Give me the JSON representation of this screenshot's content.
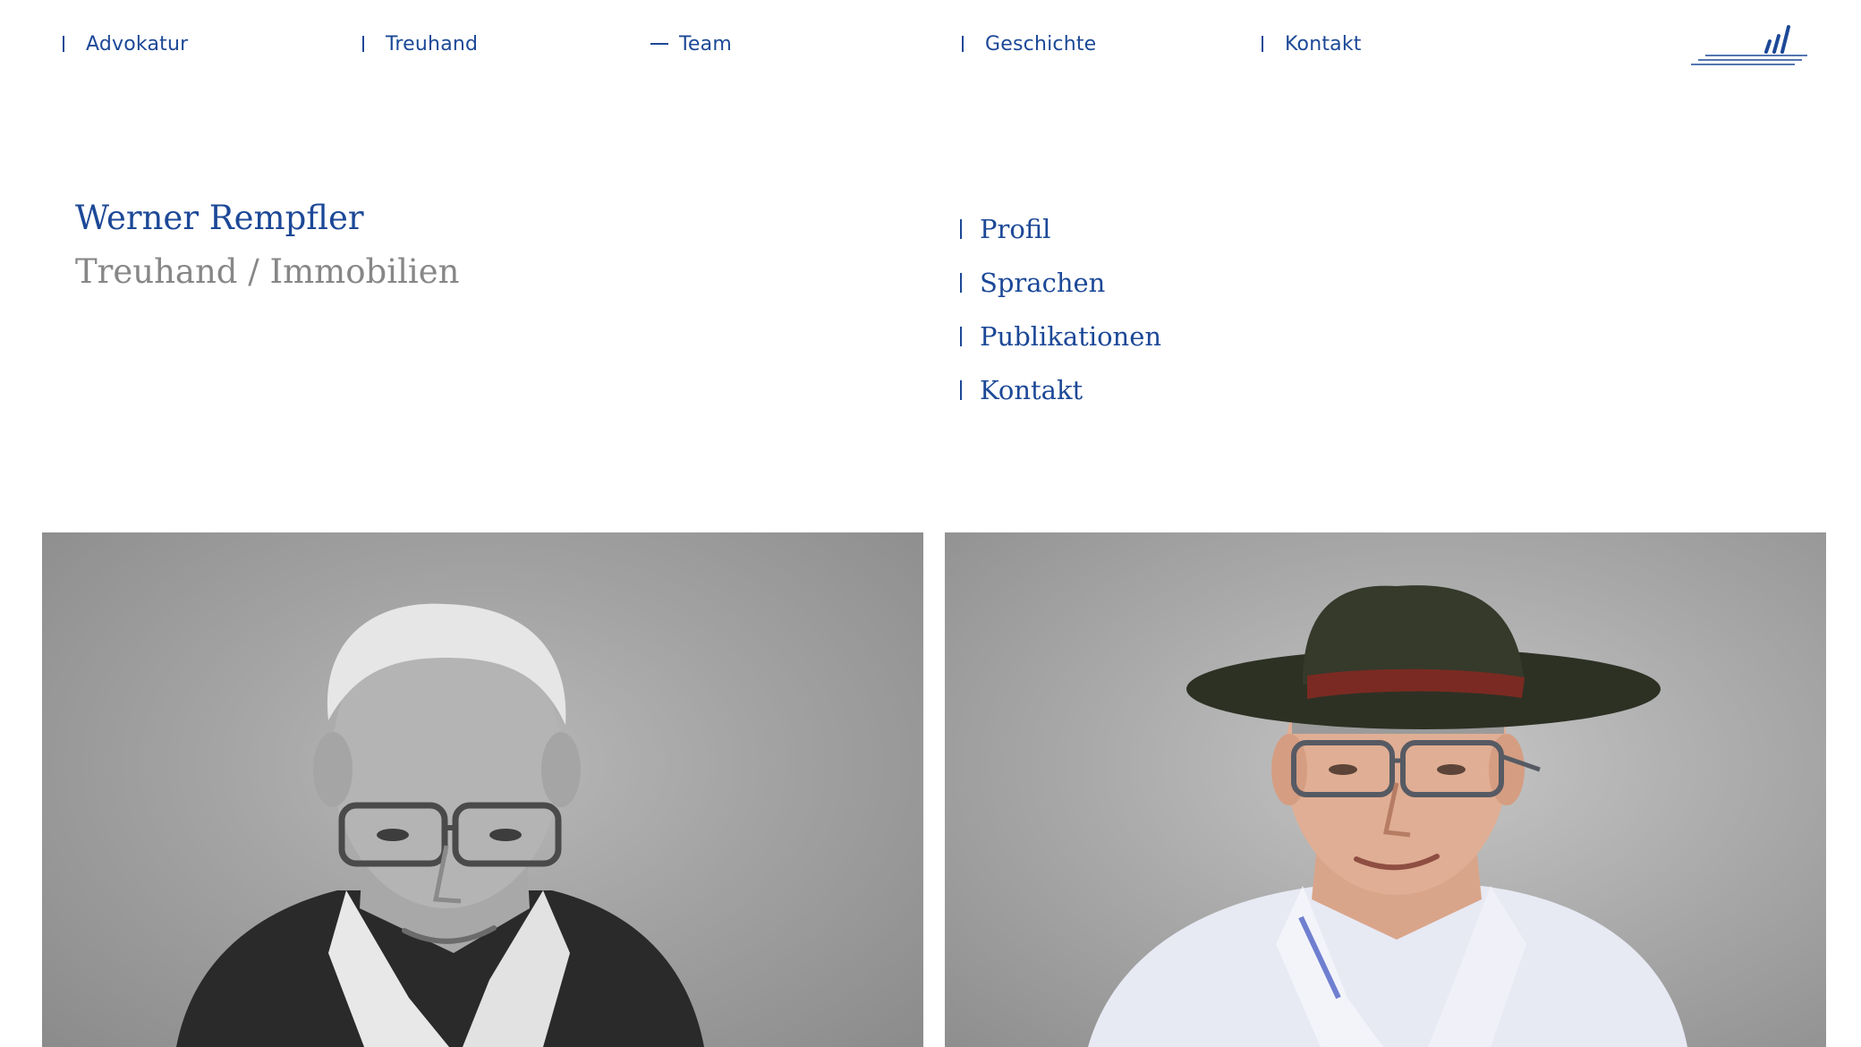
{
  "nav": {
    "items": [
      {
        "label": "Advokatur",
        "marker": "bar"
      },
      {
        "label": "Treuhand",
        "marker": "bar"
      },
      {
        "label": "Team",
        "marker": "dash"
      },
      {
        "label": "Geschichte",
        "marker": "bar"
      },
      {
        "label": "Kontakt",
        "marker": "bar"
      }
    ],
    "logo_icon": "company-logo-icon"
  },
  "person": {
    "name": "Werner Rempfler",
    "role": "Treuhand / Immobilien"
  },
  "subnav": {
    "items": [
      {
        "label": "Profil"
      },
      {
        "label": "Sprachen"
      },
      {
        "label": "Publikationen"
      },
      {
        "label": "Kontakt"
      }
    ]
  },
  "photos": [
    {
      "style": "black-and-white portrait"
    },
    {
      "style": "color portrait with hat"
    }
  ],
  "colors": {
    "brand_blue": "#1c4897",
    "role_gray": "#878787",
    "background": "#ffffff"
  }
}
